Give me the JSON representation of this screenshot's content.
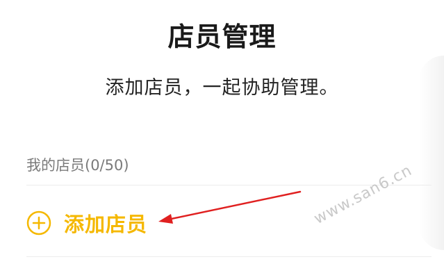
{
  "header": {
    "title": "店员管理",
    "subtitle": "添加店员，一起协助管理。"
  },
  "members": {
    "section_label": "我的店员(0/50)",
    "add_button_label": "添加店员"
  },
  "watermark": {
    "text": "www.san6.cn"
  },
  "colors": {
    "accent": "#f5b800",
    "annotation_arrow": "#e02020",
    "title_text": "#1a1a1a",
    "muted_text": "#7a7a7a",
    "divider": "#ececec"
  },
  "icons": {
    "add": "plus-circle-icon",
    "annotation": "arrow-annotation"
  }
}
